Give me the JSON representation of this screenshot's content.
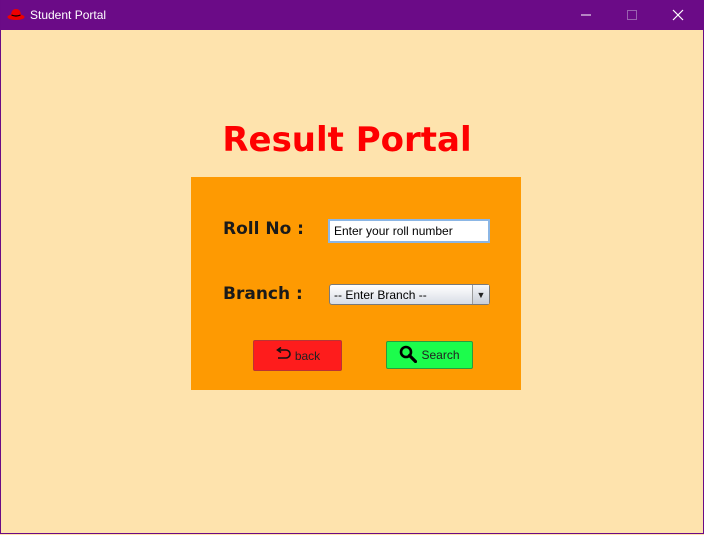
{
  "window": {
    "title": "Student Portal",
    "app_icon": "redhat-icon",
    "controls": [
      "minimize-icon",
      "maximize-icon",
      "close-icon"
    ]
  },
  "main": {
    "heading": "Result Portal",
    "form": {
      "roll_label": "Roll No :",
      "roll_value": "Enter your roll number",
      "branch_label": "Branch :",
      "branch_selected": "-- Enter Branch --"
    },
    "buttons": {
      "back_label": "back",
      "back_icon": "undo-arrow-icon",
      "search_label": "Search",
      "search_icon": "magnifier-icon"
    }
  },
  "colors": {
    "titlebar": "#6b0b87",
    "background": "#fee3ad",
    "panel": "#fe9a02",
    "heading": "#fe0000",
    "back_button": "#fe1c1c",
    "search_button": "#1cfc4c"
  }
}
